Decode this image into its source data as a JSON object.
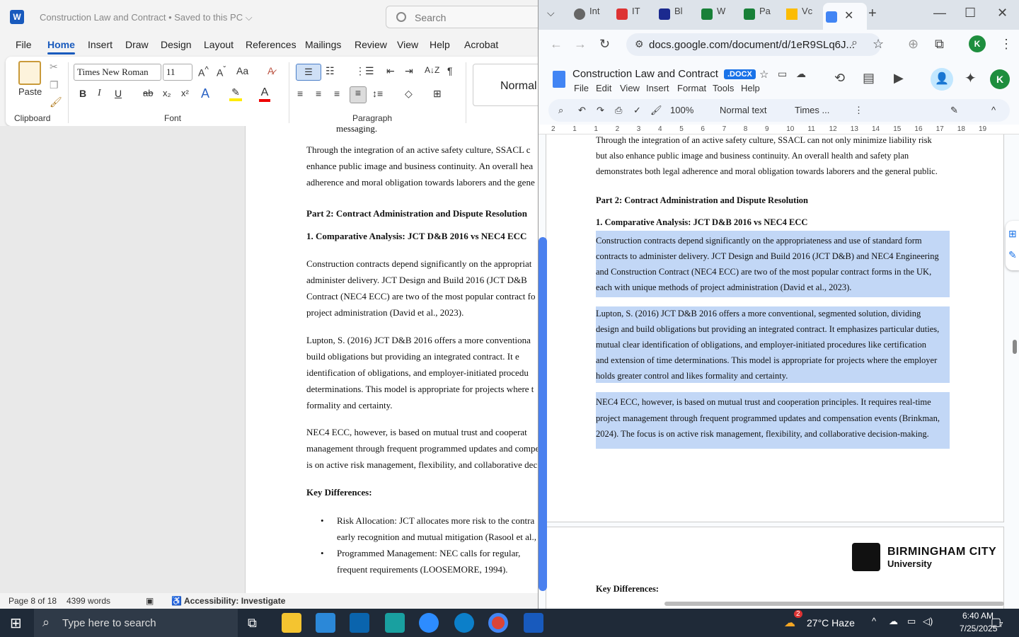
{
  "word": {
    "app_letter": "W",
    "doc_title": "Construction Law and Contract • Saved to this PC ⌵",
    "search_placeholder": "Search",
    "tabs": [
      "File",
      "Home",
      "Insert",
      "Draw",
      "Design",
      "Layout",
      "References",
      "Mailings",
      "Review",
      "View",
      "Help",
      "Acrobat"
    ],
    "ribbon": {
      "paste": "Paste",
      "clipboard": "Clipboard",
      "font_label": "Font",
      "paragraph_label": "Paragraph",
      "font_name": "Times New Roman",
      "font_size": "11",
      "style_normal": "Normal"
    },
    "page_lines": [
      {
        "text": "messaging.",
        "bold": false
      },
      {
        "text": "Through the integration of an active safety culture, SSACL c",
        "bold": false
      },
      {
        "text": "enhance public image and business continuity. An overall hea",
        "bold": false
      },
      {
        "text": "adherence and moral obligation towards laborers and the gene",
        "bold": false
      },
      {
        "text": "Part 2: Contract Administration and Dispute Resolution",
        "bold": true
      },
      {
        "text": "1. Comparative Analysis: JCT D&B 2016 vs NEC4 ECC",
        "bold": true
      },
      {
        "text": "Construction contracts depend significantly on the appropriat",
        "bold": false
      },
      {
        "text": "administer delivery. JCT Design and Build 2016 (JCT D&B",
        "bold": false
      },
      {
        "text": "Contract (NEC4 ECC) are two of the most popular contract fo",
        "bold": false
      },
      {
        "text": "project administration (David et al., 2023).",
        "bold": false
      },
      {
        "text": "Lupton, S. (2016) JCT D&B 2016 offers a more conventiona",
        "bold": false
      },
      {
        "text": "build obligations but providing an integrated contract. It e",
        "bold": false
      },
      {
        "text": "identification of obligations, and employer-initiated procedu",
        "bold": false
      },
      {
        "text": "determinations. This model is appropriate for projects where t",
        "bold": false
      },
      {
        "text": "formality and certainty.",
        "bold": false
      },
      {
        "text": "NEC4 ECC, however, is based on mutual trust and cooperat",
        "bold": false
      },
      {
        "text": "management through frequent programmed updates and compe",
        "bold": false
      },
      {
        "text": "is on active risk management, flexibility, and collaborative dec",
        "bold": false
      },
      {
        "text": "Key Differences:",
        "bold": true
      },
      {
        "text": "Risk Allocation: JCT allocates more risk to the contra",
        "bold": false
      },
      {
        "text": "early recognition and mutual mitigation (Rasool et al.,",
        "bold": false
      },
      {
        "text": "Programmed Management: NEC calls for regular,",
        "bold": false
      },
      {
        "text": "frequent requirements (LOOSEMORE, 1994).",
        "bold": false
      }
    ],
    "status": {
      "page": "Page 8 of 18",
      "words": "4399 words",
      "accessibility": "Accessibility: Investigate"
    }
  },
  "chrome": {
    "tabs": [
      "Int",
      "IT",
      "Bl",
      "W",
      "Pa",
      "Vc"
    ],
    "url": "docs.google.com/document/d/1eR9SLq6J...",
    "avatar_letter": "K"
  },
  "gdocs": {
    "title": "Construction Law and Contract",
    "badge": ".DOCX",
    "menu": [
      "File",
      "Edit",
      "View",
      "Insert",
      "Format",
      "Tools",
      "Help"
    ],
    "zoom": "100%",
    "style": "Normal text",
    "font": "Times ...",
    "ruler": [
      "2",
      "1",
      "1",
      "2",
      "3",
      "4",
      "5",
      "6",
      "7",
      "8",
      "9",
      "10",
      "11",
      "12",
      "13",
      "14",
      "15",
      "16",
      "17",
      "18",
      "19"
    ],
    "lines_top": [
      "Through the integration of an active safety culture, SSACL can not only minimize liability risk",
      "but also enhance public image and business continuity. An overall health and safety plan",
      "demonstrates both legal adherence and moral obligation towards laborers and the general public."
    ],
    "heading1": "Part 2: Contract Administration and Dispute Resolution",
    "heading2": "1. Comparative Analysis: JCT D&B 2016 vs NEC4 ECC",
    "para1": [
      "Construction contracts depend significantly on the appropriateness and use of standard form",
      "contracts to administer delivery. JCT Design and Build 2016 (JCT D&B) and NEC4 Engineering",
      "and Construction Contract (NEC4 ECC) are two of the most popular contract forms in the UK,",
      "each with unique methods of project administration (David et al., 2023)."
    ],
    "para2": [
      "Lupton, S. (2016) JCT D&B 2016 offers a more conventional, segmented solution, dividing",
      "design and build obligations but providing an integrated contract. It emphasizes particular duties,",
      "mutual clear identification of obligations, and employer-initiated procedures like certification",
      "and extension of time determinations. This model is appropriate for projects where the employer",
      "holds greater control and likes formality and certainty."
    ],
    "para3": [
      "NEC4 ECC, however, is based on mutual trust and cooperation principles. It requires real-time",
      "project management through frequent programmed updates and compensation events (Brinkman,",
      "2024). The focus is on active risk management, flexibility, and collaborative decision-making."
    ],
    "page2_logo": "BIRMINGHAM CITY",
    "page2_logo_sub": "University",
    "page2_heading": "Key Differences:"
  },
  "taskbar": {
    "search": "Type here to search",
    "weather": "27°C  Haze",
    "time": "6:40 AM",
    "date": "7/25/2025",
    "notif_count": "7",
    "weather_badge": "2"
  }
}
